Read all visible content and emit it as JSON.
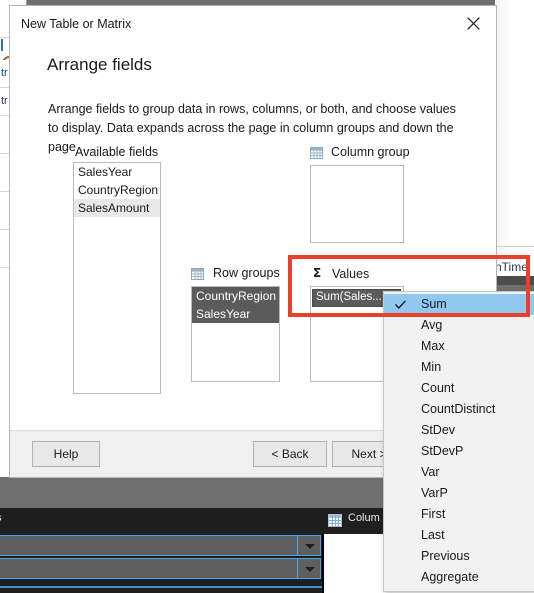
{
  "dialog": {
    "title": "New Table or Matrix",
    "close_icon": "close-icon",
    "heading": "Arrange fields",
    "description": "Arrange fields to group data in rows, columns, or both, and choose values to display. Data expands across the page in column groups and down the page ...",
    "available_fields": {
      "label": "Available fields",
      "items": [
        {
          "name": "SalesYear",
          "state": "normal"
        },
        {
          "name": "CountryRegion",
          "state": "normal"
        },
        {
          "name": "SalesAmount",
          "state": "highlighted"
        }
      ]
    },
    "column_groups": {
      "label": "Column group",
      "icon": "grid-icon",
      "items": []
    },
    "row_groups": {
      "label": "Row groups",
      "icon": "grid-icon",
      "items": [
        {
          "name": "CountryRegion",
          "state": "selected"
        },
        {
          "name": "SalesYear",
          "state": "selected"
        }
      ]
    },
    "values": {
      "label": "Values",
      "icon": "sigma-icon",
      "icon_glyph": "Σ",
      "combo_value": "Sum(Sales...",
      "combo_arrow_icon": "chevron-down-icon"
    },
    "buttons": {
      "help": "Help",
      "back": "< Back",
      "next": "Next >"
    }
  },
  "dropdown": {
    "selected": "Sum",
    "check_icon": "check-icon",
    "items": [
      "Sum",
      "Avg",
      "Max",
      "Min",
      "Count",
      "CountDistinct",
      "StDev",
      "StDevP",
      "Var",
      "VarP",
      "First",
      "Last",
      "Previous",
      "Aggregate"
    ]
  },
  "background": {
    "right_text": "nTime",
    "left_fragments": [
      "tr",
      "tr"
    ],
    "bottom_panel": {
      "left_label": "s",
      "column_label": "Colum",
      "column_icon": "grid-icon",
      "combo_arrow_icon": "chevron-down-icon"
    }
  },
  "annotation": {
    "highlight_color": "#e8402a",
    "highlight_target": "values-section"
  },
  "colors": {
    "accent_selection": "#90c8f0",
    "dark_item": "#5b5b5b",
    "desktop": "#6f6f6f"
  }
}
